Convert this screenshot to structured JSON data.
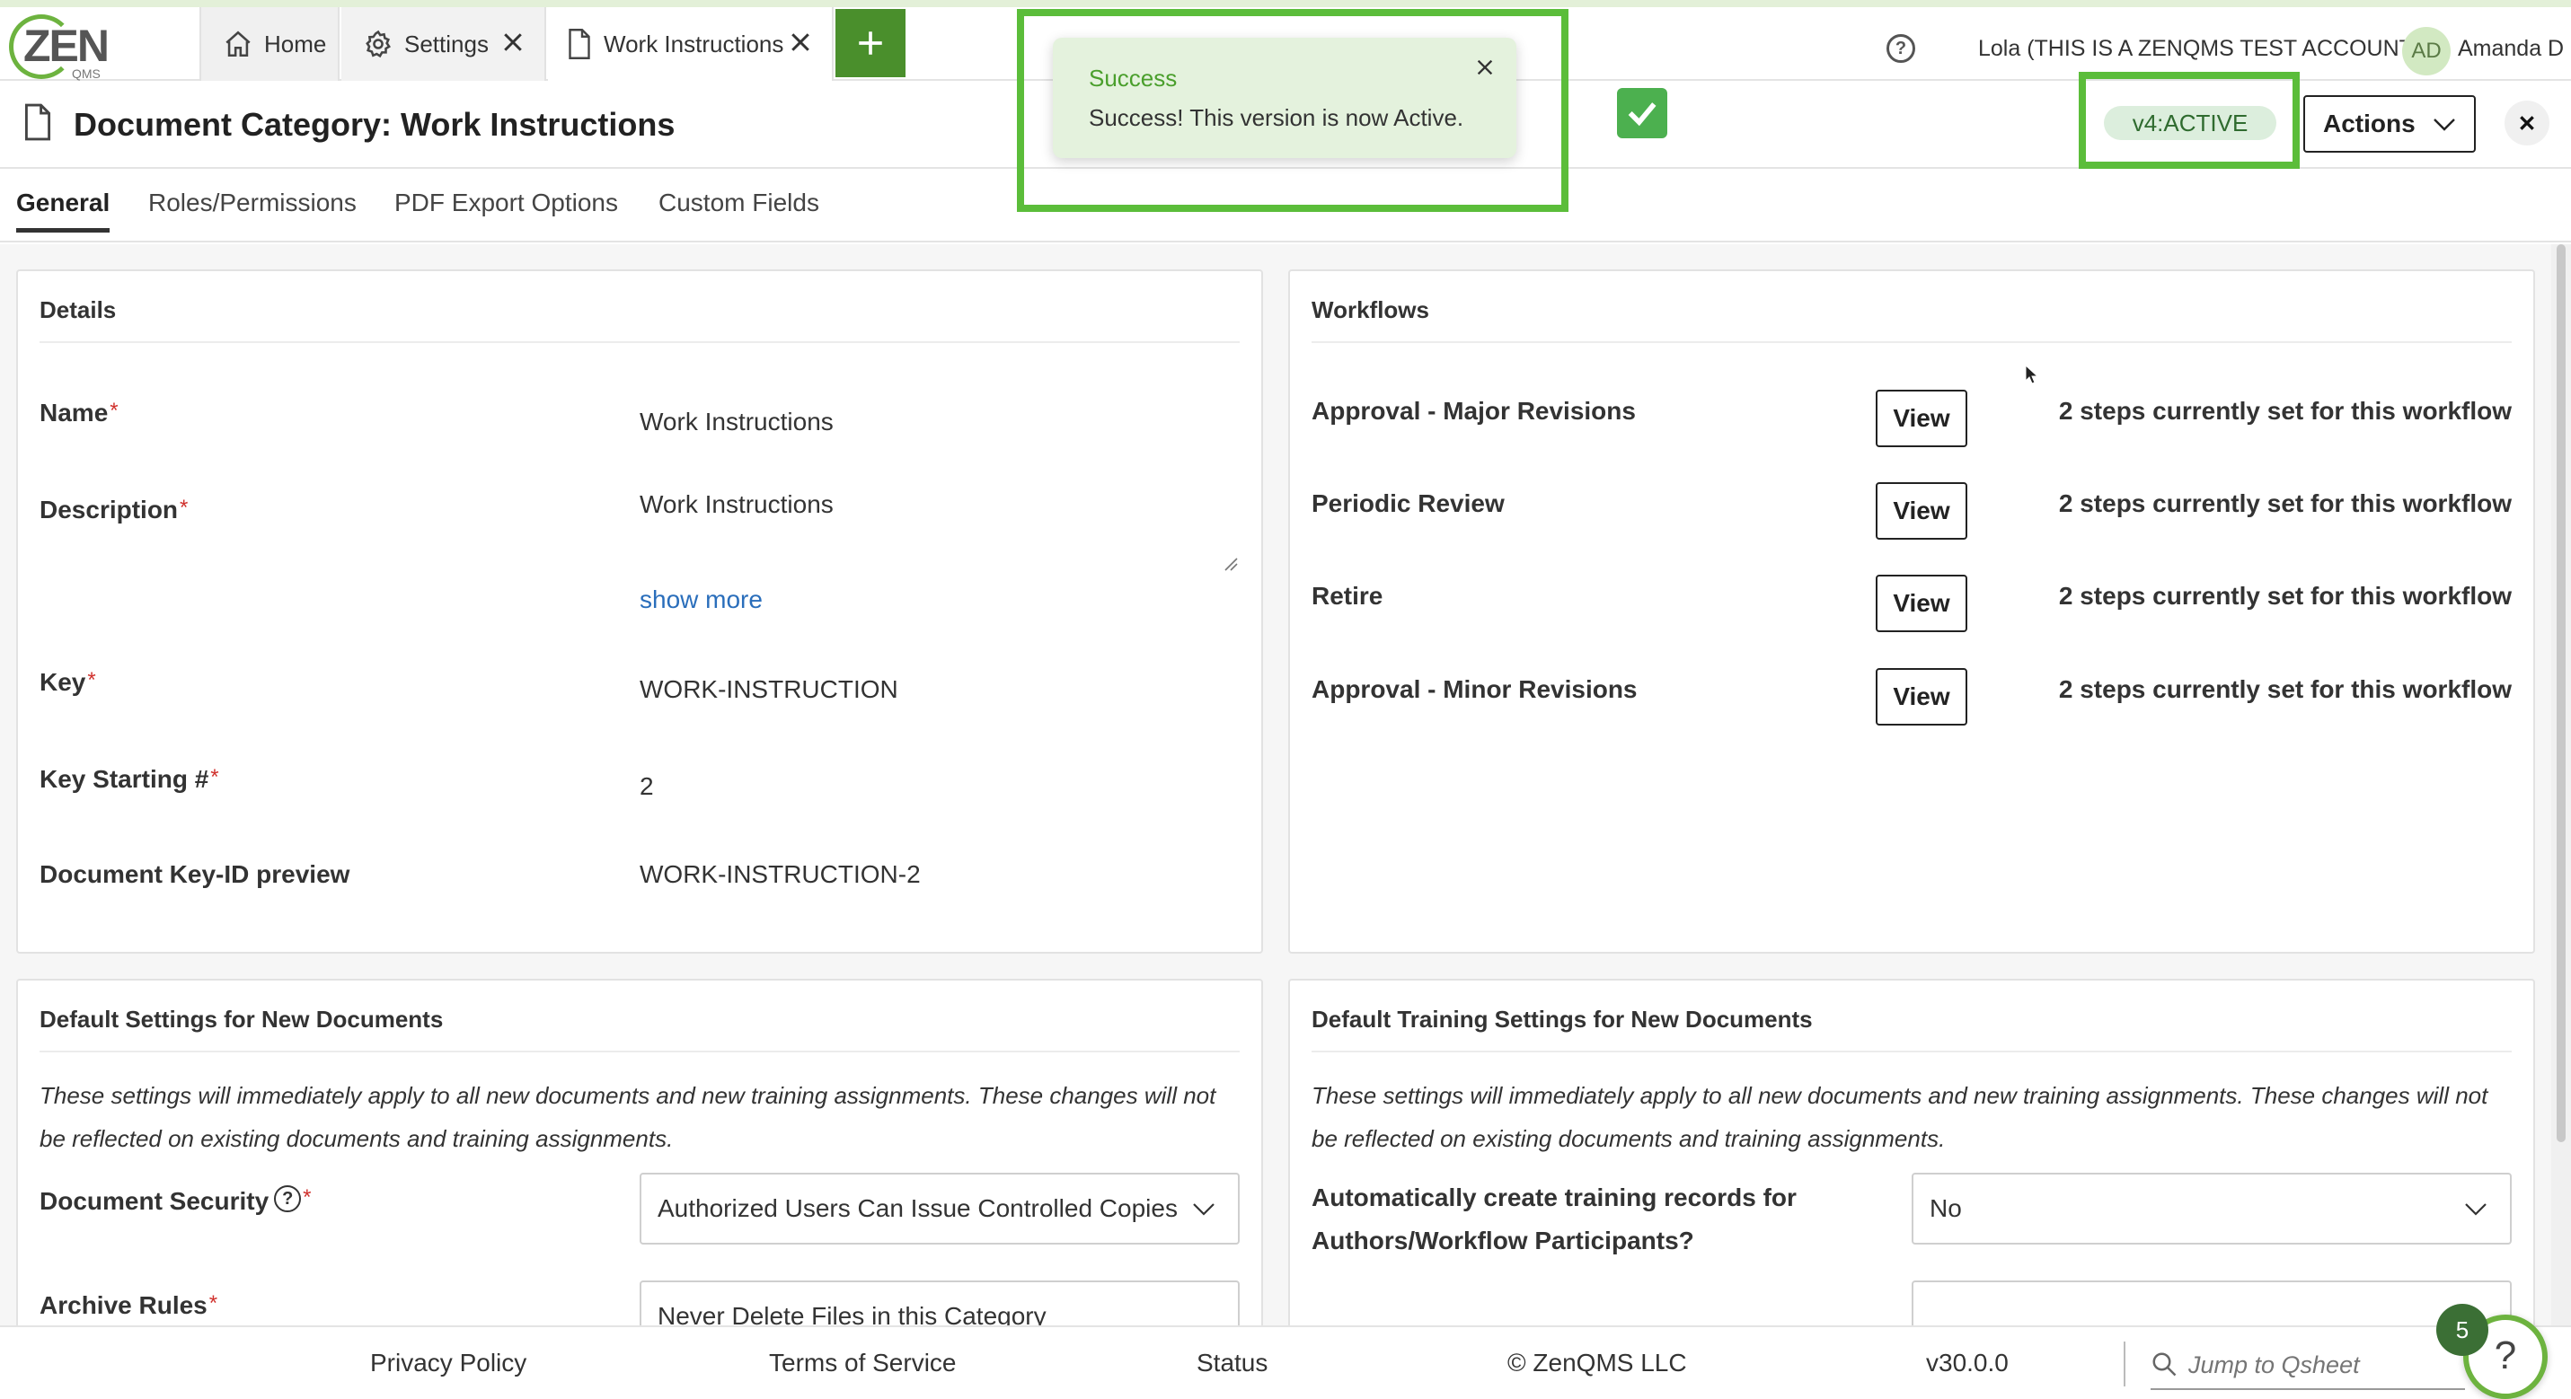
{
  "app": {
    "logo_text": "ZEN",
    "logo_sub": "QMS",
    "tabs": [
      {
        "label": "Home",
        "icon": "home-icon"
      },
      {
        "label": "Settings",
        "icon": "gear-icon"
      },
      {
        "label": "Work Instructions",
        "icon": "document-icon"
      }
    ],
    "account_label": "Lola (THIS IS A ZENQMS TEST ACCOUNT)",
    "avatar_initials": "AD",
    "user_name": "Amanda D",
    "help_icon_text": "?"
  },
  "header": {
    "title": "Document Category: Work Instructions",
    "status_badge": "v4:ACTIVE",
    "actions_label": "Actions"
  },
  "toast": {
    "title": "Success",
    "message": "Success! This version is now Active."
  },
  "subtabs": [
    "General",
    "Roles/Permissions",
    "PDF Export Options",
    "Custom Fields"
  ],
  "details": {
    "title": "Details",
    "name_label": "Name",
    "name_value": "Work Instructions",
    "description_label": "Description",
    "description_value": "Work Instructions",
    "show_more": "show more",
    "key_label": "Key",
    "key_value": "WORK-INSTRUCTION",
    "key_start_label": "Key Starting #",
    "key_start_value": "2",
    "preview_label": "Document Key-ID preview",
    "preview_value": "WORK-INSTRUCTION-2",
    "required_mark": "*"
  },
  "workflows": {
    "title": "Workflows",
    "view_label": "View",
    "items": [
      {
        "name": "Approval - Major Revisions",
        "status": "2 steps currently set for this workflow"
      },
      {
        "name": "Periodic Review",
        "status": "2 steps currently set for this workflow"
      },
      {
        "name": "Retire",
        "status": "2 steps currently set for this workflow"
      },
      {
        "name": "Approval - Minor Revisions",
        "status": "2 steps currently set for this workflow"
      }
    ]
  },
  "default_settings": {
    "title": "Default Settings for New Documents",
    "note": "These settings will immediately apply to all new documents and new training assignments. These changes will not be reflected on existing documents and training assignments.",
    "security_label": "Document Security",
    "security_value": "Authorized Users Can Issue Controlled Copies",
    "archive_label": "Archive Rules",
    "archive_value": "Never Delete Files in this Category"
  },
  "training_settings": {
    "title": "Default Training Settings for New Documents",
    "note": "These settings will immediately apply to all new documents and new training assignments. These changes will not be reflected on existing documents and training assignments.",
    "auto_label_line1": "Automatically create training records for",
    "auto_label_line2": "Authors/Workflow Participants?",
    "auto_value": "No"
  },
  "footer": {
    "privacy": "Privacy Policy",
    "terms": "Terms of Service",
    "status": "Status",
    "copyright": "© ZenQMS LLC",
    "version": "v30.0.0",
    "search_placeholder": "Jump to Qsheet",
    "help_count": "5",
    "help_label": "?"
  },
  "colors": {
    "brand_green": "#4a8f2c",
    "highlight_green": "#5bbd3a",
    "toast_bg": "#e4f2dd",
    "badge_bg": "#dceedd",
    "link_blue": "#2a6ebb",
    "required_red": "#d0312d"
  }
}
